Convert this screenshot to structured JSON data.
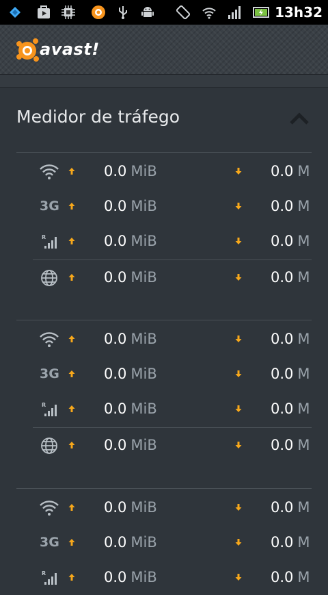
{
  "status_bar": {
    "time": "13h32",
    "icons": [
      "foursquare-icon",
      "play-store-icon",
      "cpu-icon",
      "avast-notification-icon",
      "usb-icon",
      "android-debug-icon",
      "screen-rotate-icon",
      "wifi-icon",
      "cell-signal-icon",
      "battery-charging-icon"
    ]
  },
  "app": {
    "logo_text": "avast!",
    "brand_color": "#f7941d"
  },
  "section": {
    "title": "Medidor de tráfego",
    "collapse_icon": "chevron-up-icon"
  },
  "groups": [
    {
      "rows": [
        {
          "type": "wifi",
          "icon": "wifi-icon",
          "up_value": "0.0",
          "up_unit": "MiB",
          "down_value": "0.0",
          "down_unit": "M"
        },
        {
          "type": "3g",
          "label": "3G",
          "up_value": "0.0",
          "up_unit": "MiB",
          "down_value": "0.0",
          "down_unit": "M"
        },
        {
          "type": "roaming",
          "icon": "roaming-signal-icon",
          "up_value": "0.0",
          "up_unit": "MiB",
          "down_value": "0.0",
          "down_unit": "M"
        },
        {
          "type": "total",
          "icon": "globe-icon",
          "up_value": "0.0",
          "up_unit": "MiB",
          "down_value": "0.0",
          "down_unit": "M"
        }
      ]
    },
    {
      "rows": [
        {
          "type": "wifi",
          "icon": "wifi-icon",
          "up_value": "0.0",
          "up_unit": "MiB",
          "down_value": "0.0",
          "down_unit": "M"
        },
        {
          "type": "3g",
          "label": "3G",
          "up_value": "0.0",
          "up_unit": "MiB",
          "down_value": "0.0",
          "down_unit": "M"
        },
        {
          "type": "roaming",
          "icon": "roaming-signal-icon",
          "up_value": "0.0",
          "up_unit": "MiB",
          "down_value": "0.0",
          "down_unit": "M"
        },
        {
          "type": "total",
          "icon": "globe-icon",
          "up_value": "0.0",
          "up_unit": "MiB",
          "down_value": "0.0",
          "down_unit": "M"
        }
      ]
    },
    {
      "rows": [
        {
          "type": "wifi",
          "icon": "wifi-icon",
          "up_value": "0.0",
          "up_unit": "MiB",
          "down_value": "0.0",
          "down_unit": "M"
        },
        {
          "type": "3g",
          "label": "3G",
          "up_value": "0.0",
          "up_unit": "MiB",
          "down_value": "0.0",
          "down_unit": "M"
        },
        {
          "type": "roaming",
          "icon": "roaming-signal-icon",
          "up_value": "0.0",
          "up_unit": "MiB",
          "down_value": "0.0",
          "down_unit": "M"
        }
      ]
    }
  ],
  "colors": {
    "arrow": "#f7a81b",
    "background": "#2f353b",
    "value": "#ffffff",
    "unit": "#9aa3ab"
  }
}
